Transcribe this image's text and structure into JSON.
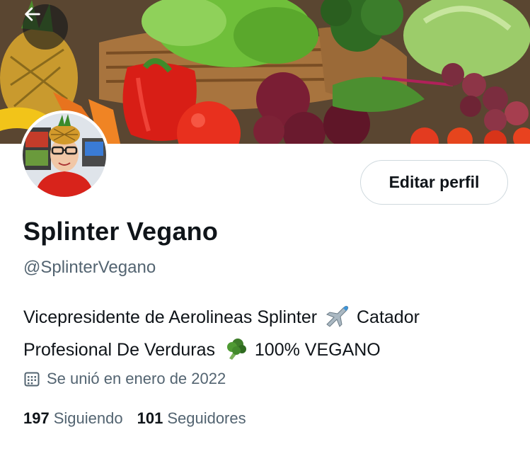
{
  "profile": {
    "display_name": "Splinter Vegano",
    "handle": "@SplinterVegano",
    "bio_part1": "Vicepresidente de Aerolineas Splinter",
    "bio_part2": "Catador Profesional De Verduras",
    "bio_part3": "100% VEGANO",
    "bio_emoji_1": "airplane-icon",
    "bio_emoji_2": "broccoli-icon",
    "joined": "Se unió en enero de 2022",
    "joined_icon": "calendar-icon"
  },
  "actions": {
    "edit_profile_label": "Editar perfil",
    "back_icon": "back-arrow-icon"
  },
  "stats": {
    "following_count": "197",
    "following_label": "Siguiendo",
    "followers_count": "101",
    "followers_label": "Seguidores"
  },
  "colors": {
    "text_primary": "#0f1419",
    "text_secondary": "#536471",
    "border": "#cfd9de"
  }
}
